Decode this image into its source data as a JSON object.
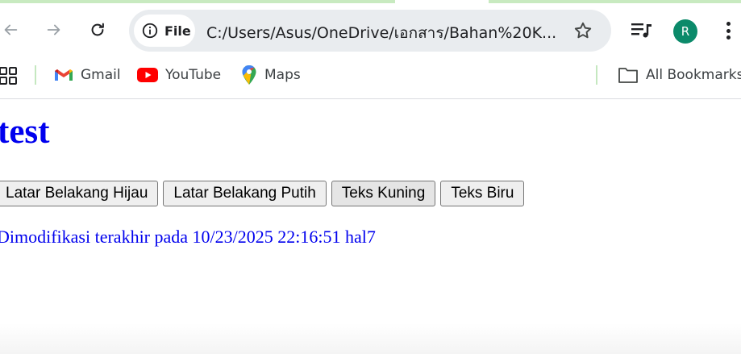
{
  "browser": {
    "omnibox": {
      "scheme_label": "File",
      "url": "C:/Users/Asus/OneDrive/เอกสาร/Bahan%20K..."
    },
    "profile_initial": "R",
    "accent_color": "#c8eac0",
    "avatar_color": "#0b8a6a"
  },
  "bookmarks": {
    "items": [
      {
        "label": "Gmail",
        "icon": "gmail-icon"
      },
      {
        "label": "YouTube",
        "icon": "youtube-icon"
      },
      {
        "label": "Maps",
        "icon": "maps-icon"
      }
    ],
    "all_bookmarks_label": "All Bookmarks"
  },
  "page": {
    "title": "test",
    "buttons": [
      {
        "label": "Latar Belakang Hijau"
      },
      {
        "label": "Latar Belakang Putih"
      },
      {
        "label": "Teks Kuning"
      },
      {
        "label": "Teks Biru"
      }
    ],
    "modified_text": "Dimodifikasi terakhir pada 10/23/2025 22:16:51 hal7",
    "text_color": "#0000ee"
  }
}
